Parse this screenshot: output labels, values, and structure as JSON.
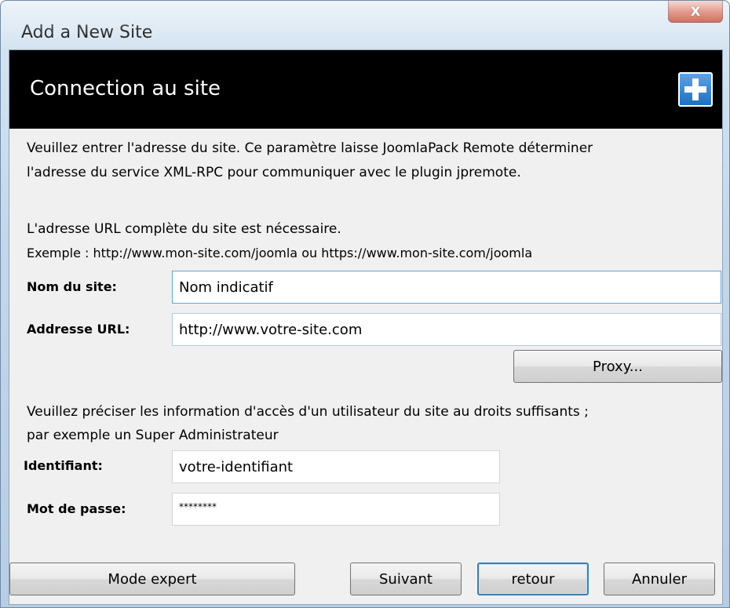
{
  "window": {
    "title": "Add a New Site",
    "close_icon": "close-icon",
    "close_label": "X"
  },
  "banner": {
    "title": "Connection au site",
    "icon": "add-plus-icon"
  },
  "intro": {
    "line1": "Veuillez entrer l'adresse du site. Ce paramètre laisse JoomlaPack Remote déterminer",
    "line2": "l'adresse du service XML-RPC pour communiquer avec le plugin jpremote.",
    "line3": "L'adresse URL complète du site est nécessaire.",
    "line4": "Exemple : http://www.mon-site.com/joomla ou https://www.mon-site.com/joomla"
  },
  "site_form": {
    "name_label": "Nom du site:",
    "name_value": "Nom indicatif",
    "url_label": "Addresse URL:",
    "url_value": "http://www.votre-site.com",
    "proxy_label": "Proxy..."
  },
  "credentials_intro": {
    "line1": "Veuillez préciser les information d'accès d'un utilisateur du site au droits suffisants ;",
    "line2": "par exemple un Super Administrateur"
  },
  "credentials_form": {
    "user_label": "Identifiant:",
    "user_value": "votre-identifiant",
    "password_label": "Mot de passe:",
    "password_value": "********"
  },
  "footer": {
    "expert_label": "Mode expert",
    "next_label": "Suivant",
    "back_label": "retour",
    "cancel_label": "Annuler"
  }
}
